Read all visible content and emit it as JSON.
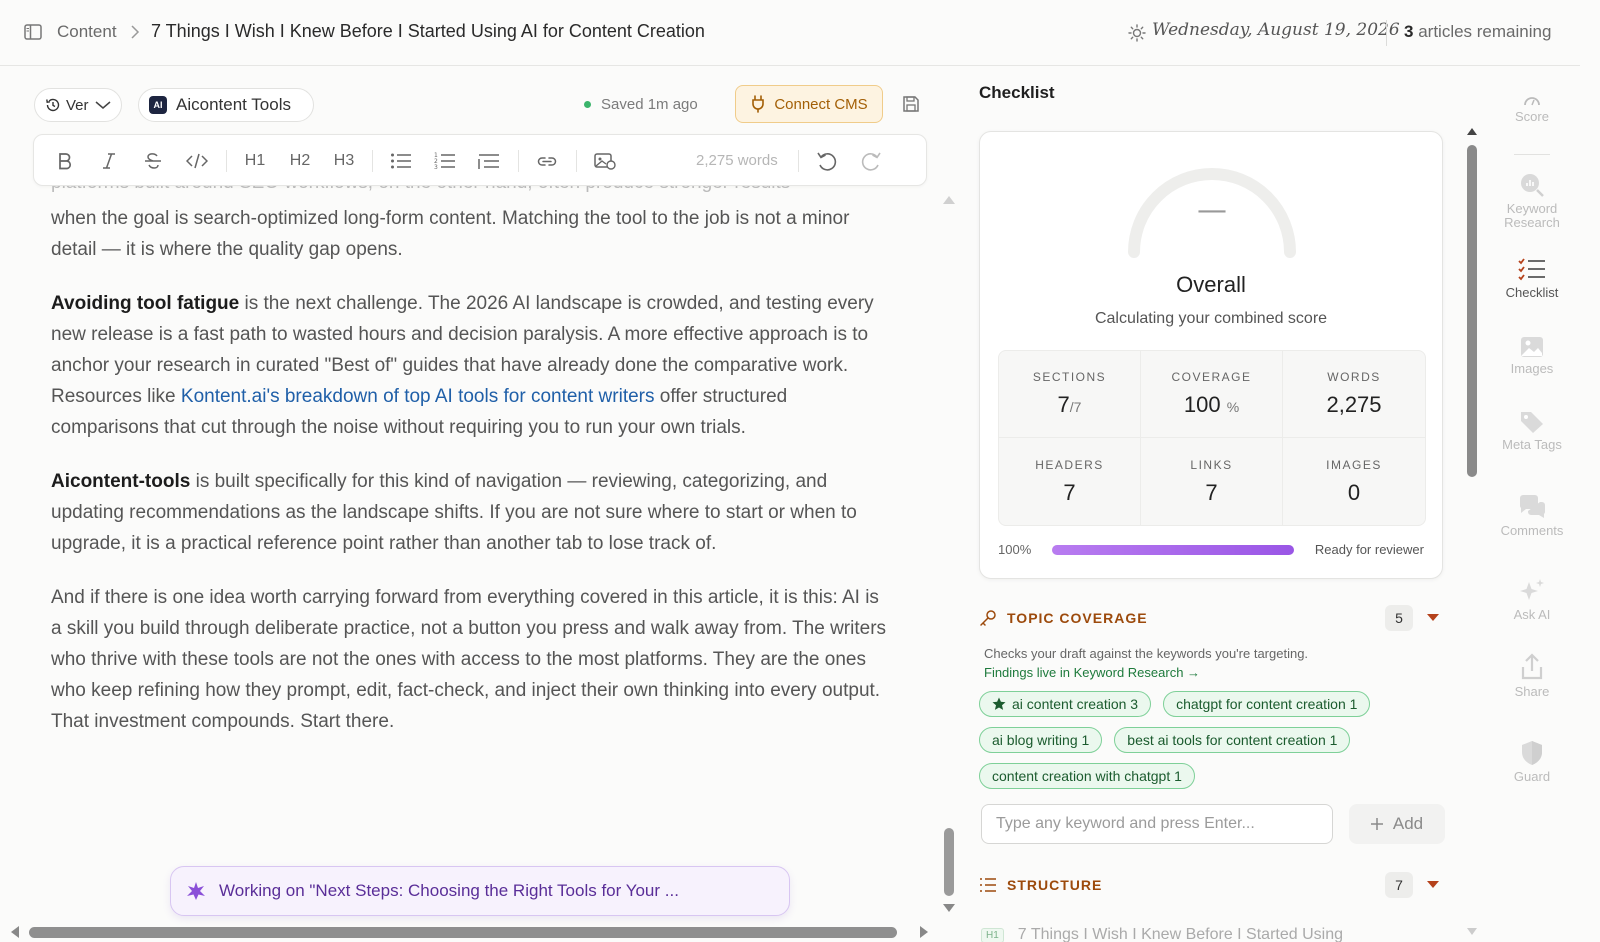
{
  "topbar": {
    "breadcrumb_root": "Content",
    "article_title": "7 Things I Wish I Knew Before I Started Using AI for Content Creation",
    "date": "Wednesday, August 19, 2026",
    "remaining_count": "3",
    "remaining_label": "articles remaining"
  },
  "editor_header": {
    "version_label": "Ver",
    "brand_label": "Aicontent Tools",
    "brand_logo_text": "AI",
    "saved_status": "Saved 1m ago",
    "connect_cms": "Connect CMS"
  },
  "toolbar": {
    "h1": "H1",
    "h2": "H2",
    "h3": "H3",
    "word_count": "2,275 words",
    "icons": [
      "bold-icon",
      "italic-icon",
      "strikethrough-icon",
      "code-icon",
      "bullet-list-icon",
      "numbered-list-icon",
      "indent-list-icon",
      "link-icon",
      "image-icon",
      "undo-icon",
      "redo-icon"
    ]
  },
  "editor": {
    "cut_line": "platforms built around SEO workflows, on the other hand, often produce stronger results",
    "p1": "when the goal is search-optimized long-form content. Matching the tool to the job is not a minor detail — it is where the quality gap opens.",
    "p2_bold": "Avoiding tool fatigue",
    "p2_a": " is the next challenge. The 2026 AI landscape is crowded, and testing every new release is a fast path to wasted hours and decision paralysis. A more effective approach is to anchor your research in curated \"Best of\" guides that have already done the comparative work. Resources like ",
    "p2_link": "Kontent.ai's breakdown of top AI tools for content writers",
    "p2_b": " offer structured comparisons that cut through the noise without requiring you to run your own trials.",
    "p3_bold": "Aicontent-tools",
    "p3": " is built specifically for this kind of navigation — reviewing, categorizing, and updating recommendations as the landscape shifts. If you are not sure where to start or when to upgrade, it is a practical reference point rather than another tab to lose track of.",
    "p4": "And if there is one idea worth carrying forward from everything covered in this article, it is this: AI is a skill you build through deliberate practice, not a button you press and walk away from. The writers who thrive with these tools are not the ones with access to the most platforms. They are the ones who keep refining how they prompt, edit, fact-check, and inject their own thinking into every output. That investment compounds. Start there."
  },
  "working_banner": "Working on \"Next Steps: Choosing the Right Tools for Your ...",
  "checklist": {
    "title": "Checklist",
    "gauge_value": "—",
    "overall_label": "Overall",
    "overall_sub": "Calculating your combined score",
    "stats": [
      {
        "label": "SECTIONS",
        "value": "7",
        "suffix": "/7"
      },
      {
        "label": "COVERAGE",
        "value": "100",
        "suffix": "%"
      },
      {
        "label": "WORDS",
        "value": "2,275",
        "suffix": ""
      },
      {
        "label": "HEADERS",
        "value": "7",
        "suffix": ""
      },
      {
        "label": "LINKS",
        "value": "7",
        "suffix": ""
      },
      {
        "label": "IMAGES",
        "value": "0",
        "suffix": ""
      }
    ],
    "progress_pct_label": "100%",
    "progress_fraction": 1.0,
    "progress_status": "Ready for reviewer",
    "topic_coverage": {
      "title": "TOPIC COVERAGE",
      "count": "5",
      "description": "Checks your draft against the keywords you're targeting.",
      "link": "Findings live in Keyword Research →",
      "keywords": [
        {
          "text": "ai content creation 3",
          "starred": true
        },
        {
          "text": "chatgpt for content creation 1",
          "starred": false
        },
        {
          "text": "ai blog writing 1",
          "starred": false
        },
        {
          "text": "best ai tools for content creation 1",
          "starred": false
        },
        {
          "text": "content creation with chatgpt 1",
          "starred": false
        }
      ],
      "input_placeholder": "Type any keyword and press Enter...",
      "add_label": "Add"
    },
    "structure": {
      "title": "STRUCTURE",
      "count": "7",
      "first_tag": "H1",
      "first_item": "7 Things I Wish I Knew Before I Started Using"
    }
  },
  "rail": {
    "score": "Score",
    "keyword_research": "Keyword Research",
    "checklist": "Checklist",
    "images": "Images",
    "meta_tags": "Meta Tags",
    "comments": "Comments",
    "ask_ai": "Ask AI",
    "share": "Share",
    "guard": "Guard"
  },
  "colors": {
    "accent_orange": "#9c4a0c",
    "cms_bg": "#fdf3e1",
    "chip_green": "#ebf8ee",
    "progress_purple": "#9a56e6",
    "link_blue": "#1f5fa8"
  }
}
